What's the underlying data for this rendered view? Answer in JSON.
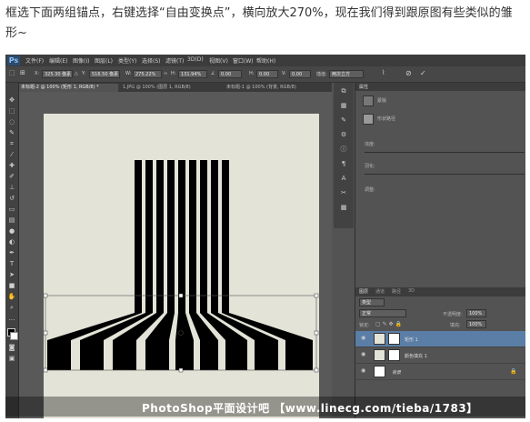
{
  "caption": "框选下面两组锚点，右键选择“自由变换点”，横向放大270%，现在我们得到跟原图有些类似的雏形~",
  "app": {
    "logo": "Ps",
    "menu": [
      "文件(F)",
      "编辑(E)",
      "图像(I)",
      "图层(L)",
      "类型(Y)",
      "选择(S)",
      "滤镜(T)",
      "3D(D)",
      "视图(V)",
      "窗口(W)",
      "帮助(H)"
    ]
  },
  "options": {
    "x_label": "X:",
    "x_value": "325.30 像素",
    "y_label": "Y:",
    "y_value": "516.50 像素",
    "w_label": "W:",
    "w_value": "275.22%",
    "h_label": "H:",
    "h_value": "131.94%",
    "angle_value": "0.00",
    "hskew_label": "H:",
    "hskew_value": "0.00",
    "vskew_label": "V:",
    "vskew_value": "0.00",
    "interp_label": "插值:",
    "interp_value": "两次立方"
  },
  "tabs": [
    {
      "label": "未标题-2 @ 100% (矩形 1, RGB/8) *",
      "active": true
    },
    {
      "label": "1.JPG @ 100% (图层 1, RGB/8)",
      "active": false
    },
    {
      "label": "未标题-1 @ 100% (背景, RGB/8)",
      "active": false
    }
  ],
  "properties": {
    "panel_title": "属性",
    "mask_label": "蒙版",
    "vector_mask_label": "形状路径",
    "density_label": "浓度:",
    "feather_label": "羽化:",
    "adjust_label": "调整:"
  },
  "layers": {
    "tabs": [
      "图层",
      "通道",
      "路径",
      "3D"
    ],
    "filter_label": "类型",
    "blend_mode": "正常",
    "opacity_label": "不透明度:",
    "opacity_value": "100%",
    "lock_label": "锁定:",
    "fill_label": "填充:",
    "fill_value": "100%",
    "items": [
      {
        "name": "矩形 1",
        "selected": true
      },
      {
        "name": "颜色填充 1",
        "selected": false
      },
      {
        "name": "背景",
        "selected": false
      }
    ]
  },
  "watermark": "PhotoShop平面设计吧  【www.linecg.com/tieba/1783】",
  "colors": {
    "stripe": "#000000",
    "canvas": "#e3e3d8",
    "selection": "#3a5f8a"
  }
}
